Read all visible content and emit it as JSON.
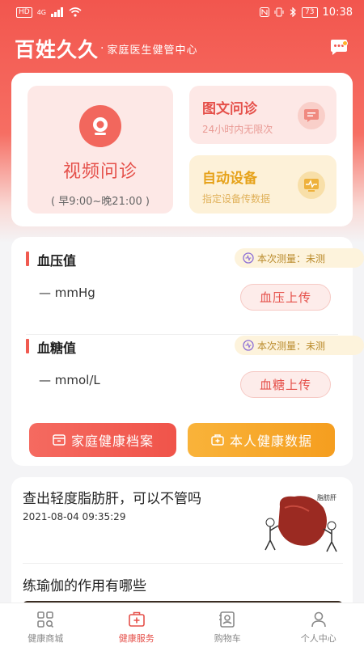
{
  "status_bar": {
    "left_chip": "HD",
    "network": "4G",
    "time": "10:38",
    "battery": "73"
  },
  "header": {
    "logo": "百姓久久",
    "separator": "·",
    "subtitle": "家庭医生健管中心"
  },
  "services": {
    "video": {
      "title": "视频问诊",
      "hours": "( 早9:00~晚21:00 )"
    },
    "text_consult": {
      "title": "图文问诊",
      "subtitle": "24小时内无限次"
    },
    "device": {
      "title": "自动设备",
      "subtitle": "指定设备传数据"
    }
  },
  "health": {
    "blood_pressure": {
      "name": "血压值",
      "status": "本次测量：未测",
      "value": "— mmHg",
      "button": "血压上传"
    },
    "blood_glucose": {
      "name": "血糖值",
      "status": "本次测量：未测",
      "value": "— mmol/L",
      "button": "血糖上传"
    },
    "archive_button": "家庭健康档案",
    "data_button": "本人健康数据"
  },
  "news": [
    {
      "title": "查出轻度脂肪肝，可以不管吗",
      "date": "2021-08-04 09:35:29",
      "thumb_caption": "脂肪肝"
    },
    {
      "title": "练瑜伽的作用有哪些"
    }
  ],
  "tabs": [
    {
      "label": "健康商城",
      "icon": "mall-icon"
    },
    {
      "label": "健康服务",
      "icon": "medical-kit-icon",
      "active": true
    },
    {
      "label": "购物车",
      "icon": "cart-icon"
    },
    {
      "label": "个人中心",
      "icon": "user-icon"
    }
  ],
  "colors": {
    "primary": "#f2564e",
    "accent": "#f59e1f",
    "active_tab": "#e5504a"
  }
}
